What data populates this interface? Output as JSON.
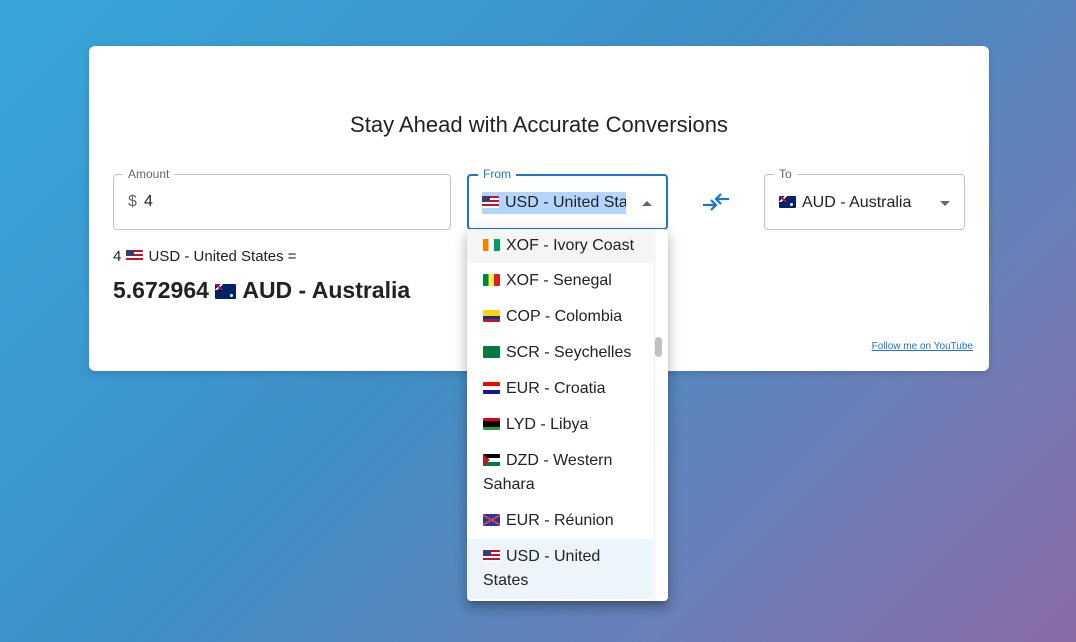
{
  "title": "Stay Ahead with Accurate Conversions",
  "amount": {
    "label": "Amount",
    "prefix": "$",
    "value": "4"
  },
  "from": {
    "label": "From",
    "value": "USD - United States",
    "flag": "us"
  },
  "to": {
    "label": "To",
    "value": "AUD - Australia",
    "flag": "au"
  },
  "result": {
    "amount": "4",
    "from_text": "USD - United States =",
    "converted": "5.672964",
    "to_text": "AUD - Australia"
  },
  "footer_link": "Follow me on YouTube",
  "dropdown_options": [
    {
      "flag": "ci",
      "label": "XOF - Ivory Coast"
    },
    {
      "flag": "sn",
      "label": "XOF - Senegal"
    },
    {
      "flag": "co",
      "label": "COP - Colombia"
    },
    {
      "flag": "sc",
      "label": "SCR - Seychelles"
    },
    {
      "flag": "hr",
      "label": "EUR - Croatia"
    },
    {
      "flag": "ly",
      "label": "LYD - Libya"
    },
    {
      "flag": "eh",
      "label": "DZD - Western Sahara"
    },
    {
      "flag": "re",
      "label": "EUR - Réunion"
    },
    {
      "flag": "us",
      "label": "USD - United States"
    }
  ],
  "icons": {
    "swap": "swap-arrows-icon",
    "caret": "chevron-icon"
  },
  "colors": {
    "accent": "#1976d2",
    "selection": "#b4d5fb"
  }
}
